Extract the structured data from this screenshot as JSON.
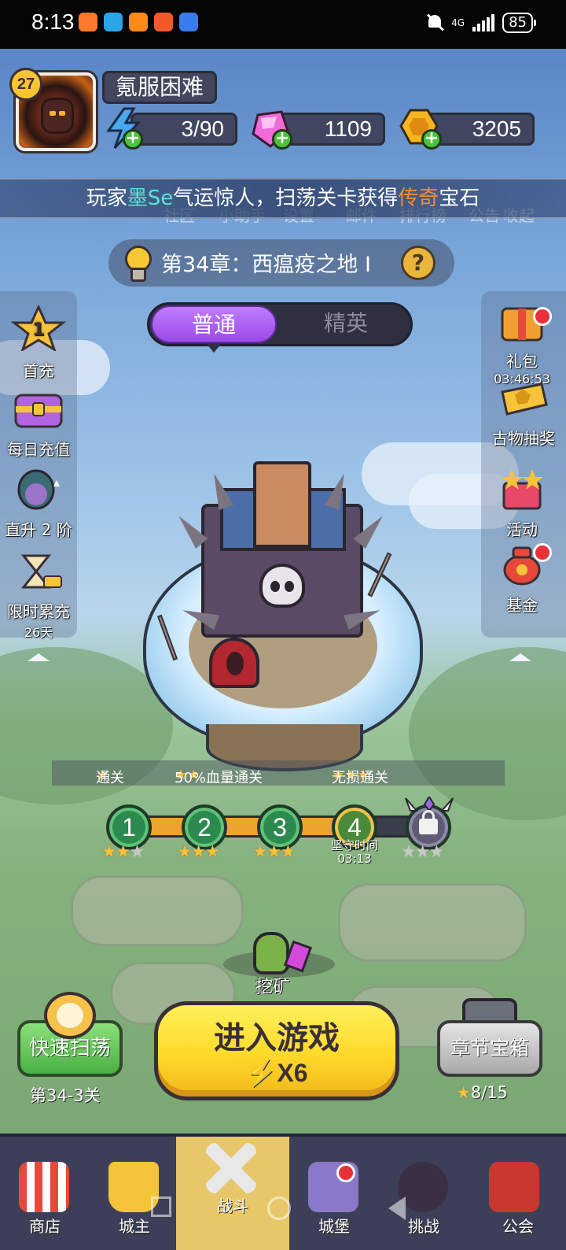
{
  "status_bar": {
    "time": "8:13",
    "network": "4G",
    "battery": "85",
    "icons": [
      "notification-app-icon",
      "notification-app-icon",
      "notification-app-icon",
      "notification-app-icon",
      "notification-app-icon",
      "bell-muted-icon",
      "signal-icon",
      "battery-icon"
    ]
  },
  "player": {
    "level": "27",
    "name": "氪服困难"
  },
  "resources": {
    "energy": "3/90",
    "gems": "1109",
    "gold": "3205"
  },
  "broadcast": {
    "prefix": "玩家",
    "player": "墨Se",
    "middle": "气运惊人，扫荡关卡获得",
    "highlight": "传奇",
    "suffix": "宝石"
  },
  "menu_behind": {
    "items": [
      "社区",
      "小助手",
      "设置",
      "邮件",
      "排行榜",
      "公告",
      "收起"
    ]
  },
  "chapter": {
    "title": "第34章：西瘟疫之地 Ⅰ"
  },
  "difficulty": {
    "normal": "普通",
    "elite": "精英",
    "selected": "普通"
  },
  "left_menu": {
    "first_charge": "首充",
    "first_charge_badge": "1",
    "daily_recharge": "每日充值",
    "upgrade": "直升 2 阶",
    "limited_recharge": "限时累充",
    "limited_days": "26天"
  },
  "right_menu": {
    "gift": "礼包",
    "gift_timer": "03:46:53",
    "relic_draw": "古物抽奖",
    "activity": "活动",
    "fund": "基金"
  },
  "rating_legend": {
    "one_star": "通关",
    "two_star": "50%血量通关",
    "three_star": "无损通关"
  },
  "stages": [
    {
      "number": "1",
      "stars": 2
    },
    {
      "number": "2",
      "stars": 3
    },
    {
      "number": "3",
      "stars": 3
    },
    {
      "number": "4",
      "stars": 0
    },
    {
      "number": "",
      "stars": 0,
      "locked": true
    }
  ],
  "stage_progress": 0.75,
  "guard": {
    "label": "坚守时间",
    "time": "03:13"
  },
  "mining": {
    "label": "挖矿"
  },
  "actions": {
    "sweep_label": "快速扫荡",
    "sweep_stage": "第34-3关",
    "play_label": "进入游戏",
    "play_cost": "X6",
    "chest_label": "章节宝箱",
    "chest_progress": "8/15"
  },
  "nav": {
    "items": [
      "商店",
      "城主",
      "战斗",
      "城堡",
      "挑战",
      "公会"
    ],
    "active": "战斗"
  },
  "colors": {
    "accent_yellow": "#ffd92a",
    "accent_purple": "#9b4ae6",
    "green_button": "#4ab043",
    "legend_orange": "#ff8a2a",
    "name_cyan": "#58e5d8"
  }
}
